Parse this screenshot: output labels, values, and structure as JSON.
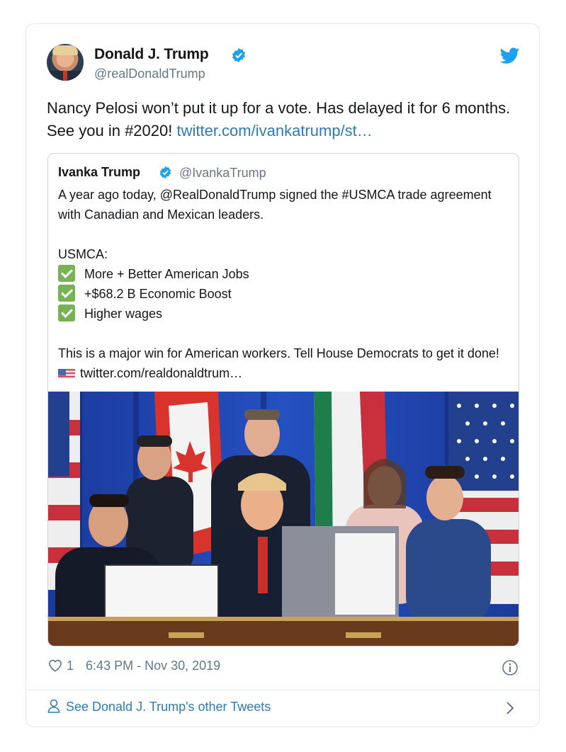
{
  "author": {
    "name": "Donald J. Trump",
    "handle": "@realDonaldTrump",
    "avatar_icon": "user-avatar",
    "verified_icon": "verified-badge-icon"
  },
  "tweet": {
    "text_before_link": "Nancy Pelosi won’t put it up for a vote. Has delayed it for 6 months. See you in #2020! ",
    "link_text": "twitter.com/ivankatrump/st…"
  },
  "quoted_tweet": {
    "name": "Ivanka Trump",
    "handle": "@IvankaTrump",
    "intro": "A year ago today, @RealDonaldTrump signed the #USMCA trade agreement with Canadian and Mexican leaders.",
    "list_heading": "USMCA:",
    "checklist": [
      "More + Better American Jobs",
      "+$68.2 B Economic Boost",
      "Higher wages"
    ],
    "closing": "This is a major win for American workers. Tell House Democrats to get it done!",
    "closing_link": "twitter.com/realdonaldtrum…",
    "image_icon": "signing-ceremony-photo"
  },
  "meta": {
    "like_count": "1",
    "timestamp": "6:43 PM - Nov 30, 2019"
  },
  "footer": {
    "see_more_label": "See Donald J. Trump's other Tweets"
  },
  "colors": {
    "link": "#2b7bb9",
    "twitter_blue": "#1da1f2",
    "muted": "#657786",
    "border": "#e1e8ed"
  }
}
